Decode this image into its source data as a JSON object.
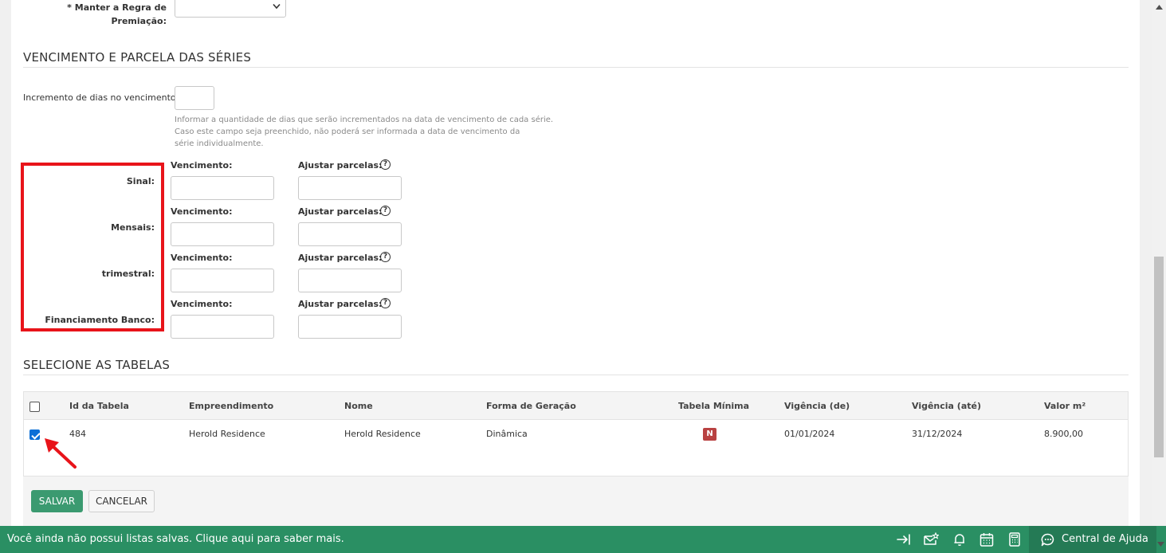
{
  "top_field": {
    "label_line1": "* Manter a Regra de",
    "label_line2": "Premiação:"
  },
  "vencimento_section": {
    "title": "VENCIMENTO E PARCELA DAS SÉRIES",
    "increment_label": "Incremento de dias no vencimento:",
    "increment_value": "",
    "hint_line1": "Informar a quantidade de dias que serão incrementados na data de vencimento de cada série.",
    "hint_line2": "Caso este campo seja preenchido, não poderá ser informada a data de vencimento da",
    "hint_line3": "série individualmente.",
    "series": [
      {
        "name": "Sinal:",
        "venc_label": "Vencimento:",
        "ajust_label": "Ajustar parcelas:"
      },
      {
        "name": "Mensais:",
        "venc_label": "Vencimento:",
        "ajust_label": "Ajustar parcelas:"
      },
      {
        "name": "trimestral:",
        "venc_label": "Vencimento:",
        "ajust_label": "Ajustar parcelas:"
      },
      {
        "name": "Financiamento Banco:",
        "venc_label": "Vencimento:",
        "ajust_label": "Ajustar parcelas:"
      }
    ],
    "help_glyph": "?"
  },
  "tables_section": {
    "title": "SELECIONE AS TABELAS",
    "columns": [
      "Id da Tabela",
      "Empreendimento",
      "Nome",
      "Forma de Geração",
      "Tabela Mínima",
      "Vigência (de)",
      "Vigência (até)",
      "Valor m²"
    ],
    "rows": [
      {
        "checked": true,
        "id": "484",
        "empreendimento": "Herold Residence",
        "nome": "Herold Residence",
        "forma": "Dinâmica",
        "tabela_minima": "N",
        "vig_de": "01/01/2024",
        "vig_ate": "31/12/2024",
        "valor": "8.900,00"
      }
    ]
  },
  "actions": {
    "save_label": "SALVAR",
    "cancel_label": "CANCELAR"
  },
  "footer": {
    "message": "Você ainda não possui listas salvas. Clique aqui para saber mais.",
    "help_center_label": "Central de Ajuda"
  },
  "colors": {
    "footer_bg": "#2a8f63",
    "save_button": "#3b9a70",
    "badge_red": "#b94242",
    "annotation_red": "#e8141a",
    "checkbox_blue": "#0b6fd6"
  }
}
